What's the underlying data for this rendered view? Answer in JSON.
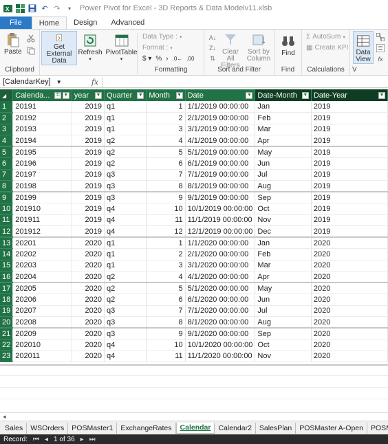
{
  "title": "Power Pivot for Excel - 3D Reports & Data Modelv11.xlsb",
  "tabs": {
    "file": "File",
    "home": "Home",
    "design": "Design",
    "advanced": "Advanced"
  },
  "ribbon": {
    "paste": "Paste",
    "get_external_data": "Get External Data",
    "refresh": "Refresh",
    "pivottable": "PivotTable",
    "data_type": "Data Type :",
    "format": "Format :",
    "clear_all_filters": "Clear All Filters",
    "sort_by_column": "Sort by Column",
    "find": "Find",
    "autosum": "AutoSum",
    "create_kpi": "Create KPI",
    "data_view": "Data View",
    "groups": {
      "clipboard": "Clipboard",
      "formatting": "Formatting",
      "sort_filter": "Sort and Filter",
      "find": "Find",
      "calculations": "Calculations",
      "view": "V"
    }
  },
  "formula_bar": {
    "name_box": "[CalendarKey]",
    "fx": "fx"
  },
  "columns": [
    "Calenda...",
    "year",
    "Quarter",
    "Month",
    "Date",
    "Date-Month",
    "Date-Year"
  ],
  "rows": [
    [
      "1",
      "20191",
      "2019",
      "q1",
      "1",
      "1/1/2019 00:00:00",
      "Jan",
      "2019"
    ],
    [
      "2",
      "20192",
      "2019",
      "q1",
      "2",
      "2/1/2019 00:00:00",
      "Feb",
      "2019"
    ],
    [
      "3",
      "20193",
      "2019",
      "q1",
      "3",
      "3/1/2019 00:00:00",
      "Mar",
      "2019"
    ],
    [
      "4",
      "20194",
      "2019",
      "q2",
      "4",
      "4/1/2019 00:00:00",
      "Apr",
      "2019"
    ],
    [
      "5",
      "20195",
      "2019",
      "q2",
      "5",
      "5/1/2019 00:00:00",
      "May",
      "2019"
    ],
    [
      "6",
      "20196",
      "2019",
      "q2",
      "6",
      "6/1/2019 00:00:00",
      "Jun",
      "2019"
    ],
    [
      "7",
      "20197",
      "2019",
      "q3",
      "7",
      "7/1/2019 00:00:00",
      "Jul",
      "2019"
    ],
    [
      "8",
      "20198",
      "2019",
      "q3",
      "8",
      "8/1/2019 00:00:00",
      "Aug",
      "2019"
    ],
    [
      "9",
      "20199",
      "2019",
      "q3",
      "9",
      "9/1/2019 00:00:00",
      "Sep",
      "2019"
    ],
    [
      "10",
      "201910",
      "2019",
      "q4",
      "10",
      "10/1/2019 00:00:00",
      "Oct",
      "2019"
    ],
    [
      "11",
      "201911",
      "2019",
      "q4",
      "11",
      "11/1/2019 00:00:00",
      "Nov",
      "2019"
    ],
    [
      "12",
      "201912",
      "2019",
      "q4",
      "12",
      "12/1/2019 00:00:00",
      "Dec",
      "2019"
    ],
    [
      "13",
      "20201",
      "2020",
      "q1",
      "1",
      "1/1/2020 00:00:00",
      "Jan",
      "2020"
    ],
    [
      "14",
      "20202",
      "2020",
      "q1",
      "2",
      "2/1/2020 00:00:00",
      "Feb",
      "2020"
    ],
    [
      "15",
      "20203",
      "2020",
      "q1",
      "3",
      "3/1/2020 00:00:00",
      "Mar",
      "2020"
    ],
    [
      "16",
      "20204",
      "2020",
      "q2",
      "4",
      "4/1/2020 00:00:00",
      "Apr",
      "2020"
    ],
    [
      "17",
      "20205",
      "2020",
      "q2",
      "5",
      "5/1/2020 00:00:00",
      "May",
      "2020"
    ],
    [
      "18",
      "20206",
      "2020",
      "q2",
      "6",
      "6/1/2020 00:00:00",
      "Jun",
      "2020"
    ],
    [
      "19",
      "20207",
      "2020",
      "q3",
      "7",
      "7/1/2020 00:00:00",
      "Jul",
      "2020"
    ],
    [
      "20",
      "20208",
      "2020",
      "q3",
      "8",
      "8/1/2020 00:00:00",
      "Aug",
      "2020"
    ],
    [
      "21",
      "20209",
      "2020",
      "q3",
      "9",
      "9/1/2020 00:00:00",
      "Sep",
      "2020"
    ],
    [
      "22",
      "202010",
      "2020",
      "q4",
      "10",
      "10/1/2020 00:00:00",
      "Oct",
      "2020"
    ],
    [
      "23",
      "202011",
      "2020",
      "q4",
      "11",
      "11/1/2020 00:00:00",
      "Nov",
      "2020"
    ]
  ],
  "sheet_tabs": [
    "Sales",
    "WSOrders",
    "POSMaster1",
    "ExchangeRates",
    "Calendar",
    "Calendar2",
    "SalesPlan",
    "POSMaster A-Open",
    "POSMaster B-Close"
  ],
  "active_sheet": "Calendar",
  "status": {
    "record_label": "Record:",
    "nav_first": "⏮",
    "nav_prev": "◂",
    "position": "1 of 36",
    "nav_next": "▸",
    "nav_last": "⏭"
  },
  "colors": {
    "header_green": "#217346",
    "file_blue": "#2b79c9"
  }
}
